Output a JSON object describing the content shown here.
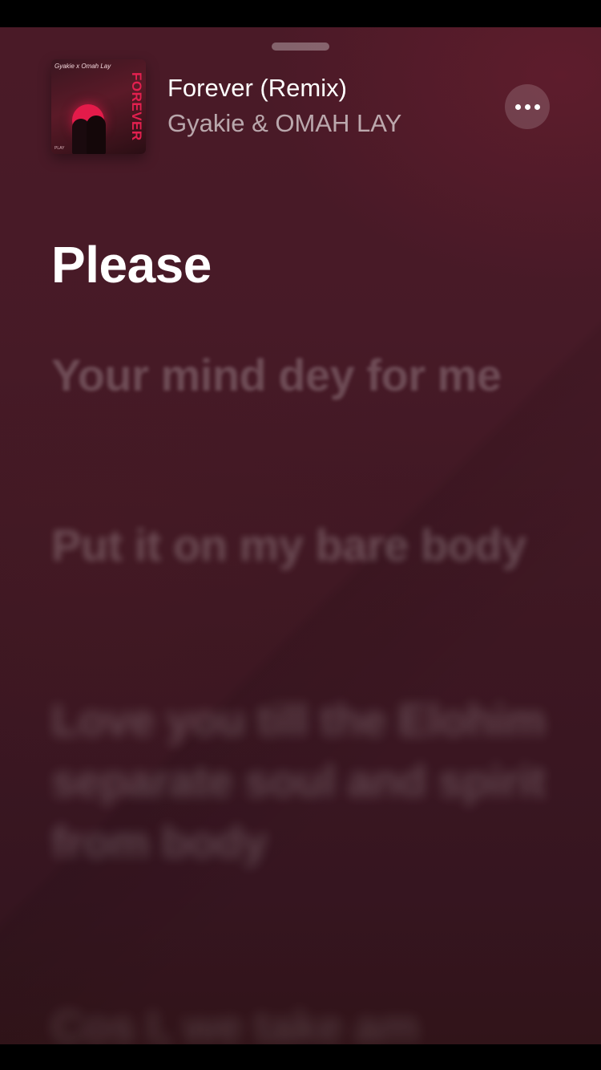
{
  "now_playing": {
    "title": "Forever (Remix)",
    "artist": "Gyakie & OMAH LAY",
    "artwork": {
      "vertical_text": "FOREVER",
      "script_text": "Gyakie x Omah Lay",
      "footer_text": "PLAY",
      "accent_color": "#e31b4a"
    },
    "more_icon": "ellipsis-icon"
  },
  "lyrics": {
    "previous": "",
    "active": "Please",
    "upcoming": [
      "Your mind dey for me",
      "Put it on my bare body",
      "Love you till the Elohim separate soul and spirit from body",
      "Cos I, we take am"
    ]
  }
}
